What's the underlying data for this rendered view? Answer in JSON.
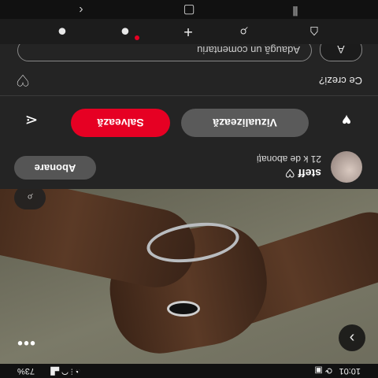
{
  "status_bar": {
    "time": "10:01",
    "battery": "73%",
    "left_icons": [
      "sync-icon",
      "photo-icon"
    ],
    "right_icons": [
      "alarm-icon",
      "vibrate-icon",
      "wifi-icon",
      "signal-icon",
      "battery-icon"
    ]
  },
  "pin": {
    "next_symbol": "›",
    "more_symbol": "•••"
  },
  "creator": {
    "name": "steff ♡",
    "subscribers": "21 k de abonați",
    "follow_label": "Abonare"
  },
  "actions": {
    "view_label": "Vizualizează",
    "save_label": "Salvează"
  },
  "comments": {
    "prompt": "Ce crezi?",
    "avatar_letter": "A",
    "placeholder": "Adaugă un comentariu"
  },
  "tab_bar": {
    "items": [
      "home-icon",
      "search-icon",
      "add-icon",
      "messages-icon",
      "profile-icon"
    ],
    "notification_dot_color": "#e60023"
  },
  "colors": {
    "accent": "#e60023",
    "background": "#242424"
  }
}
